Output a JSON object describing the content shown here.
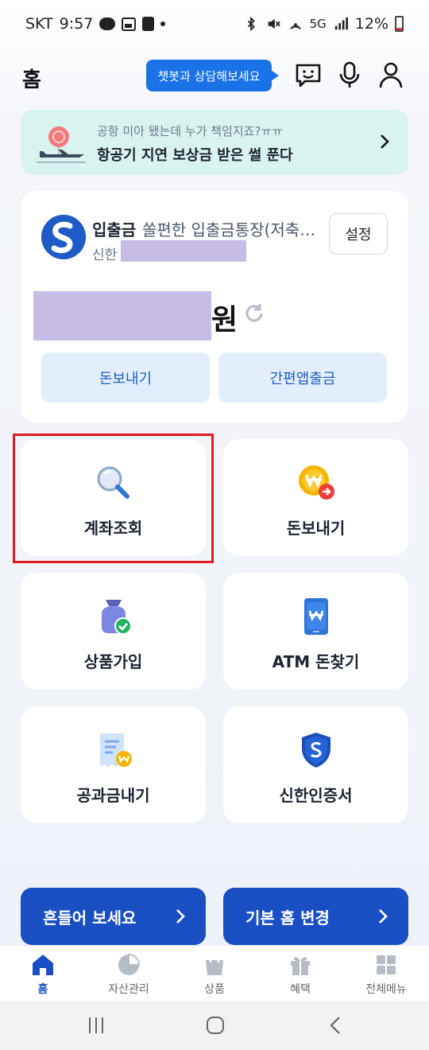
{
  "status_bar": {
    "carrier": "SKT",
    "time": "9:57",
    "talk_badge": "TALK",
    "network": "5G",
    "battery": "12%"
  },
  "header": {
    "title": "홈",
    "chatbot_prompt": "챗봇과 상담해보세요"
  },
  "banner": {
    "subtitle": "공항 미아 됐는데 누가 책임지죠?ㅠㅠ",
    "title": "항공기 지연 보상금 받은 썰 푼다"
  },
  "account": {
    "type": "입출금",
    "name": "쏠편한 입출금통장(저축예금)",
    "bank": "신한",
    "balance_unit": "원",
    "settings_label": "설정",
    "transfer_label": "돈보내기",
    "easy_withdraw_label": "간편앱출금"
  },
  "menu": {
    "tiles": [
      {
        "label": "계좌조회",
        "icon": "magnifier-icon"
      },
      {
        "label": "돈보내기",
        "icon": "coin-transfer-icon"
      },
      {
        "label": "상품가입",
        "icon": "money-bag-icon"
      },
      {
        "label": "ATM 돈찾기",
        "icon": "phone-atm-icon"
      },
      {
        "label": "공과금내기",
        "icon": "receipt-icon"
      },
      {
        "label": "신한인증서",
        "icon": "shield-icon"
      }
    ]
  },
  "actions": {
    "shake_label": "흔들어 보세요",
    "change_home_label": "기본 홈 변경"
  },
  "bottom_nav": {
    "items": [
      {
        "label": "홈",
        "icon": "home-icon",
        "active": true
      },
      {
        "label": "자산관리",
        "icon": "pie-chart-icon"
      },
      {
        "label": "상품",
        "icon": "shopping-bag-icon"
      },
      {
        "label": "혜택",
        "icon": "gift-icon"
      },
      {
        "label": "전체메뉴",
        "icon": "grid-icon"
      }
    ]
  },
  "colors": {
    "accent": "#1a4fc4",
    "pill": "#1a72e8",
    "banner_bg": "#d9f3ef",
    "highlight": "#e01b24",
    "mask": "#c7bce6"
  }
}
